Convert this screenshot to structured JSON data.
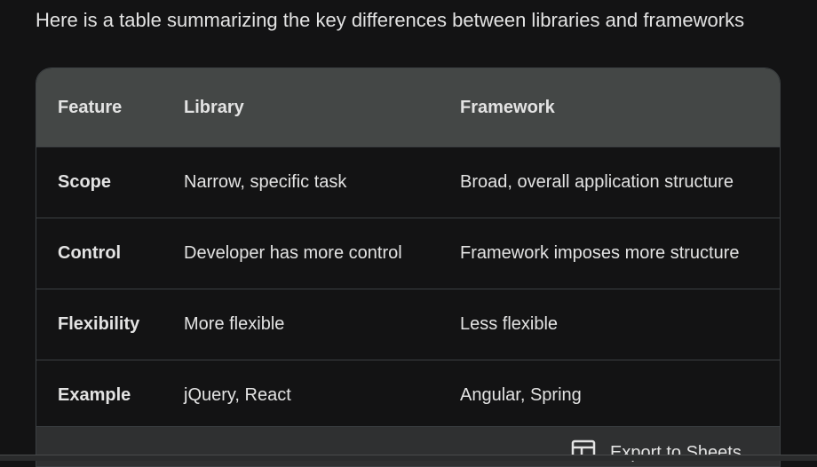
{
  "intro_text": "Here is a table summarizing the key differences between libraries and frameworks",
  "table": {
    "headers": [
      "Feature",
      "Library",
      "Framework"
    ],
    "rows": [
      [
        "Scope",
        "Narrow, specific task",
        "Broad, overall application structure"
      ],
      [
        "Control",
        "Developer has more control",
        "Framework imposes more structure"
      ],
      [
        "Flexibility",
        "More flexible",
        "Less flexible"
      ],
      [
        "Example",
        "jQuery, React",
        "Angular, Spring"
      ]
    ]
  },
  "export": {
    "label": "Export to Sheets",
    "icon": "table-icon"
  },
  "colors": {
    "background": "#131314",
    "header_bg": "#444746",
    "footer_bg": "#2f3031",
    "text": "#e3e3e3"
  }
}
